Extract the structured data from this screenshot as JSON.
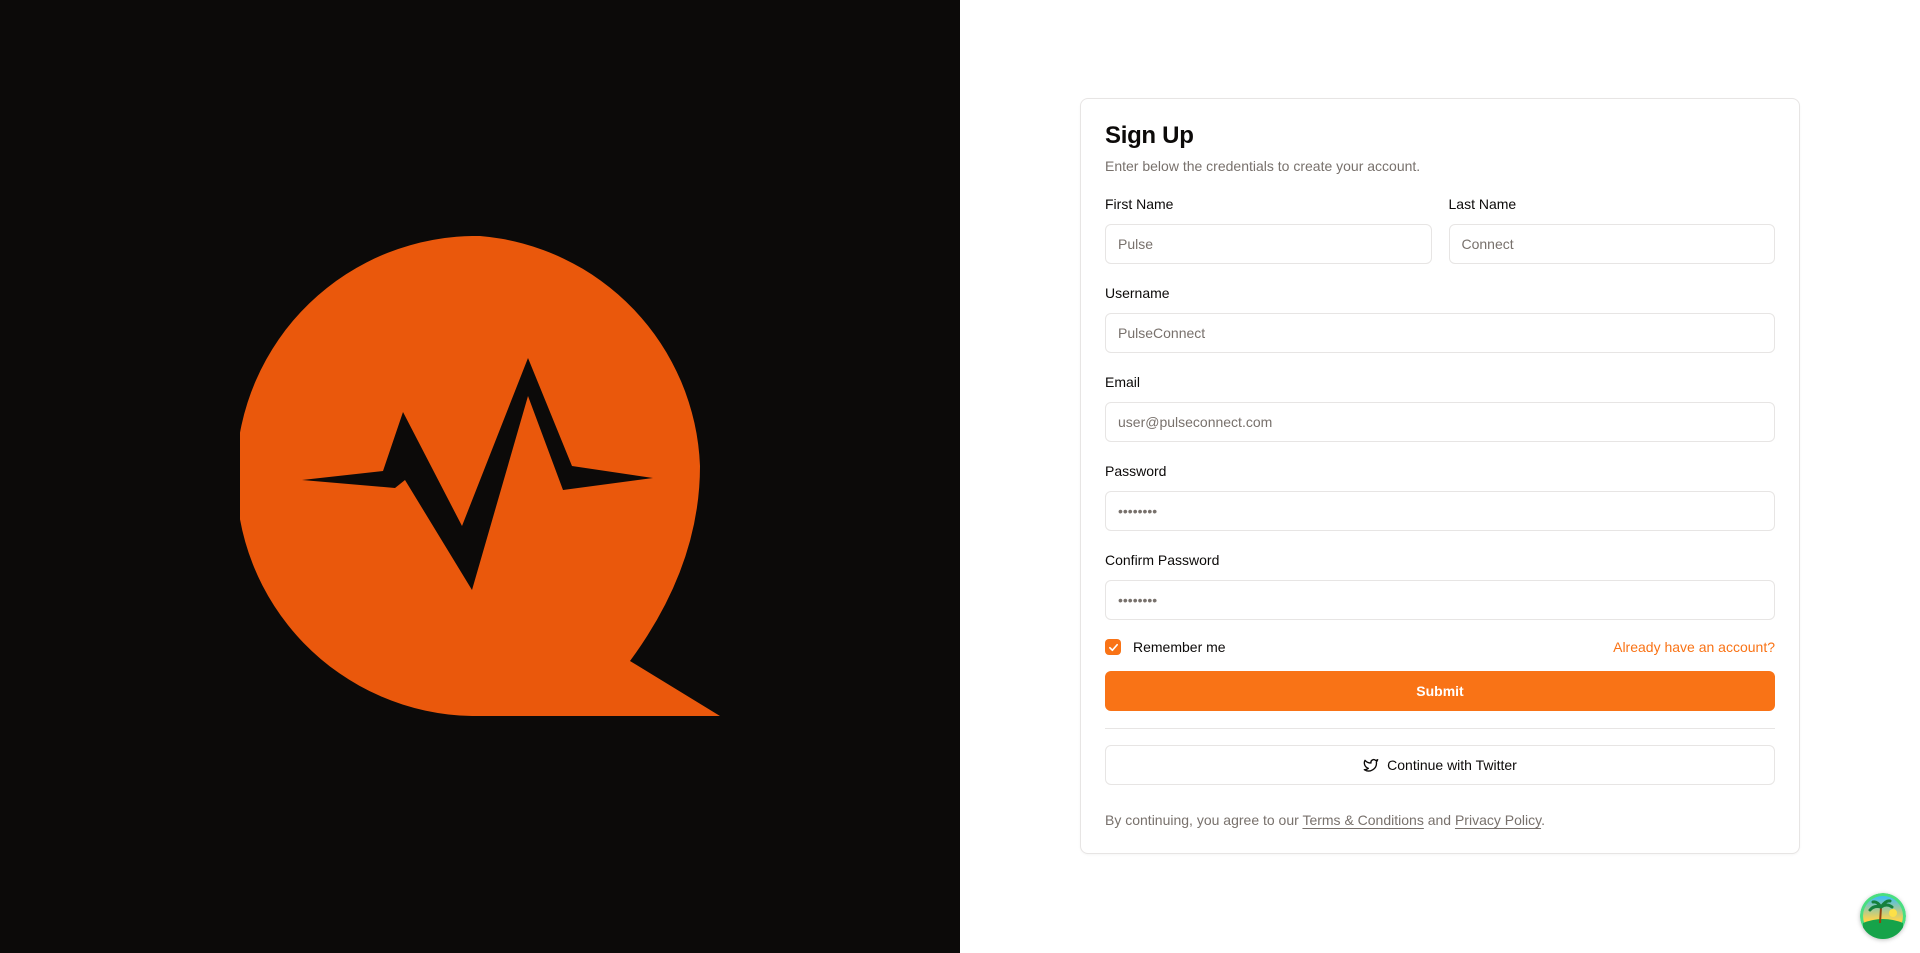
{
  "brand": {
    "logo_icon": "pulse-chat-bubble-icon",
    "colors": {
      "accent": "#f97316",
      "logo_orange": "#ea580c",
      "dark_bg": "#0c0a09"
    }
  },
  "form": {
    "title": "Sign Up",
    "description": "Enter below the credentials to create your account.",
    "first_name": {
      "label": "First Name",
      "placeholder": "Pulse"
    },
    "last_name": {
      "label": "Last Name",
      "placeholder": "Connect"
    },
    "username": {
      "label": "Username",
      "placeholder": "PulseConnect"
    },
    "email": {
      "label": "Email",
      "placeholder": "user@pulseconnect.com"
    },
    "password": {
      "label": "Password",
      "placeholder": "••••••••"
    },
    "confirm_password": {
      "label": "Confirm Password",
      "placeholder": "••••••••"
    },
    "remember_me": {
      "label": "Remember me",
      "checked": true
    },
    "account_link": "Already have an account?",
    "submit_label": "Submit",
    "twitter_label": "Continue with Twitter",
    "terms": {
      "prefix": "By continuing, you agree to our ",
      "terms_link": "Terms & Conditions",
      "conjunction": " and ",
      "privacy_link": "Privacy Policy",
      "suffix": "."
    }
  },
  "floating_widget": {
    "icon": "island-avatar-icon"
  }
}
